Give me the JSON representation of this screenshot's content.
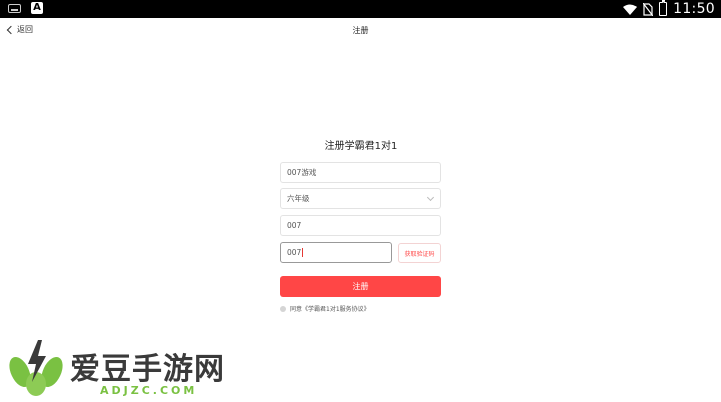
{
  "status_bar": {
    "time": "11:50",
    "app_icon_letter": "A"
  },
  "header": {
    "back_label": "返回",
    "title": "注册"
  },
  "form": {
    "title": "注册学霸君1对1",
    "nickname_value": "007游戏",
    "grade_value": "六年级",
    "phone_value": "007",
    "code_value": "007",
    "get_code_label": "获取验证码",
    "submit_label": "注册",
    "agreement_text": "同意《学霸君1对1服务协议》"
  },
  "watermark": {
    "cn": "爱豆手游网",
    "en": "ADJZC.COM"
  },
  "colors": {
    "accent": "#ff4646",
    "watermark_green": "#7ac142"
  }
}
